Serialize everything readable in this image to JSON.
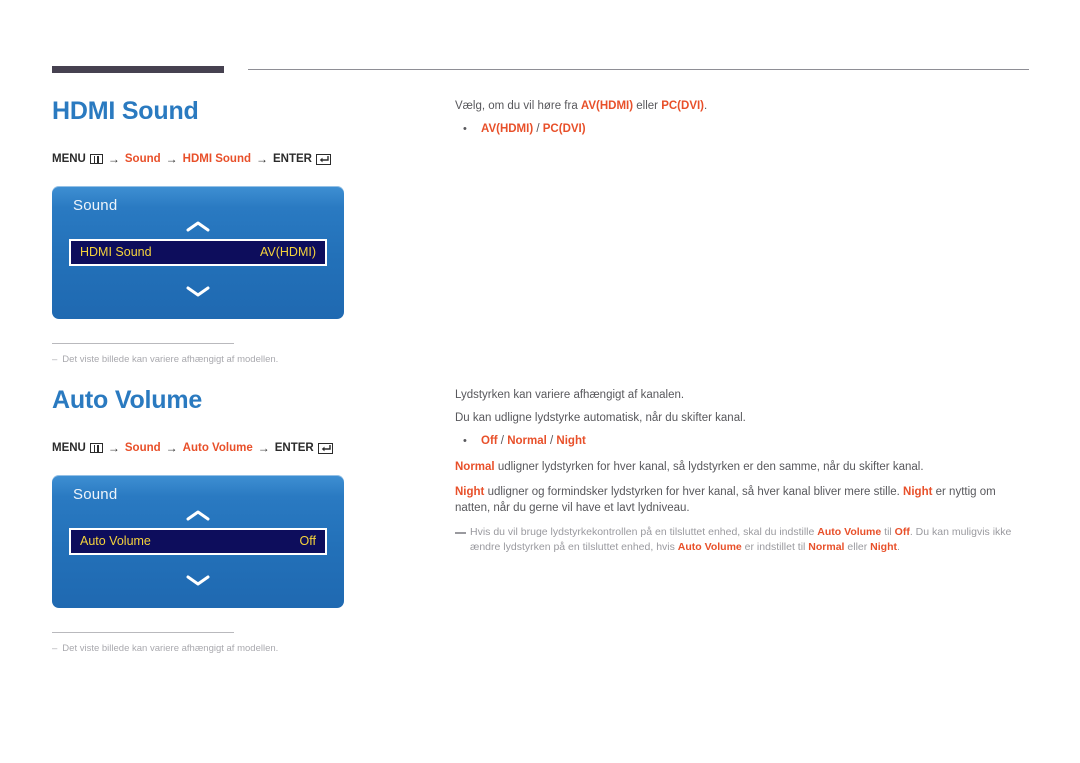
{
  "page": {
    "background": "#ffffff",
    "accent_blue": "#2a7ac0",
    "accent_orange": "#e8502a",
    "body_gray": "#58585c",
    "note_gray": "#9a9a9f"
  },
  "sections": [
    {
      "id": "hdmi-sound",
      "title": "HDMI Sound",
      "menu_path": {
        "menu_label": "MENU",
        "menu_icon": "menu-grid-icon",
        "arrow": "→",
        "steps": [
          "Sound",
          "HDMI Sound"
        ],
        "enter_label": "ENTER",
        "enter_icon": "enter-return-icon"
      },
      "osd": {
        "title": "Sound",
        "chevron_up_icon": "chevron-up-icon",
        "chevron_down_icon": "chevron-down-icon",
        "row_label": "HDMI Sound",
        "row_value": "AV(HDMI)",
        "highlight_bg": "#0d0d5c",
        "highlight_text": "#f5d33c"
      },
      "footnote": {
        "dash": "–",
        "text": "Det viste billede kan variere afhængigt af modellen."
      },
      "right": {
        "intro_parts": [
          {
            "t": "Vælg, om du vil høre fra ",
            "s": "plain"
          },
          {
            "t": "AV(HDMI)",
            "s": "accent"
          },
          {
            "t": " eller ",
            "s": "plain"
          },
          {
            "t": "PC(DVI)",
            "s": "accent"
          },
          {
            "t": ".",
            "s": "plain"
          }
        ],
        "bullet": {
          "dot": "•",
          "options": [
            "AV(HDMI)",
            "PC(DVI)"
          ],
          "separator": " / "
        }
      }
    },
    {
      "id": "auto-volume",
      "title": "Auto Volume",
      "menu_path": {
        "menu_label": "MENU",
        "menu_icon": "menu-grid-icon",
        "arrow": "→",
        "steps": [
          "Sound",
          "Auto Volume"
        ],
        "enter_label": "ENTER",
        "enter_icon": "enter-return-icon"
      },
      "osd": {
        "title": "Sound",
        "chevron_up_icon": "chevron-up-icon",
        "chevron_down_icon": "chevron-down-icon",
        "row_label": "Auto Volume",
        "row_value": "Off",
        "highlight_bg": "#0d0d5c",
        "highlight_text": "#f5d33c"
      },
      "footnote": {
        "dash": "–",
        "text": "Det viste billede kan variere afhængigt af modellen."
      },
      "right": {
        "p1": "Lydstyrken kan variere afhængigt af kanalen.",
        "p2": "Du kan udligne lydstyrke automatisk, når du skifter kanal.",
        "bullet": {
          "dot": "•",
          "options": [
            "Off",
            "Normal",
            "Night"
          ],
          "separator": " / "
        },
        "p3_parts": [
          {
            "t": "Normal",
            "s": "accent"
          },
          {
            "t": " udligner lydstyrken for hver kanal, så lydstyrken er den samme, når du skifter kanal.",
            "s": "plain"
          }
        ],
        "p4_parts": [
          {
            "t": "Night",
            "s": "accent"
          },
          {
            "t": " udligner og formindsker lydstyrken for hver kanal, så hver kanal bliver mere stille. ",
            "s": "plain"
          },
          {
            "t": "Night",
            "s": "accent"
          },
          {
            "t": " er nyttig om natten, når du gerne vil have et lavt lydniveau.",
            "s": "plain"
          }
        ],
        "note_parts": [
          {
            "t": "Hvis du vil bruge lydstyrkekontrollen på en tilsluttet enhed, skal du indstille ",
            "s": "plain"
          },
          {
            "t": "Auto Volume",
            "s": "accent"
          },
          {
            "t": " til ",
            "s": "plain"
          },
          {
            "t": "Off",
            "s": "accent"
          },
          {
            "t": ". Du kan muligvis ikke ændre lydstyrken på en tilsluttet enhed, hvis ",
            "s": "plain"
          },
          {
            "t": "Auto Volume",
            "s": "accent"
          },
          {
            "t": " er indstillet til ",
            "s": "plain"
          },
          {
            "t": "Normal",
            "s": "accent"
          },
          {
            "t": " eller ",
            "s": "plain"
          },
          {
            "t": "Night",
            "s": "accent"
          },
          {
            "t": ".",
            "s": "plain"
          }
        ]
      }
    }
  ]
}
